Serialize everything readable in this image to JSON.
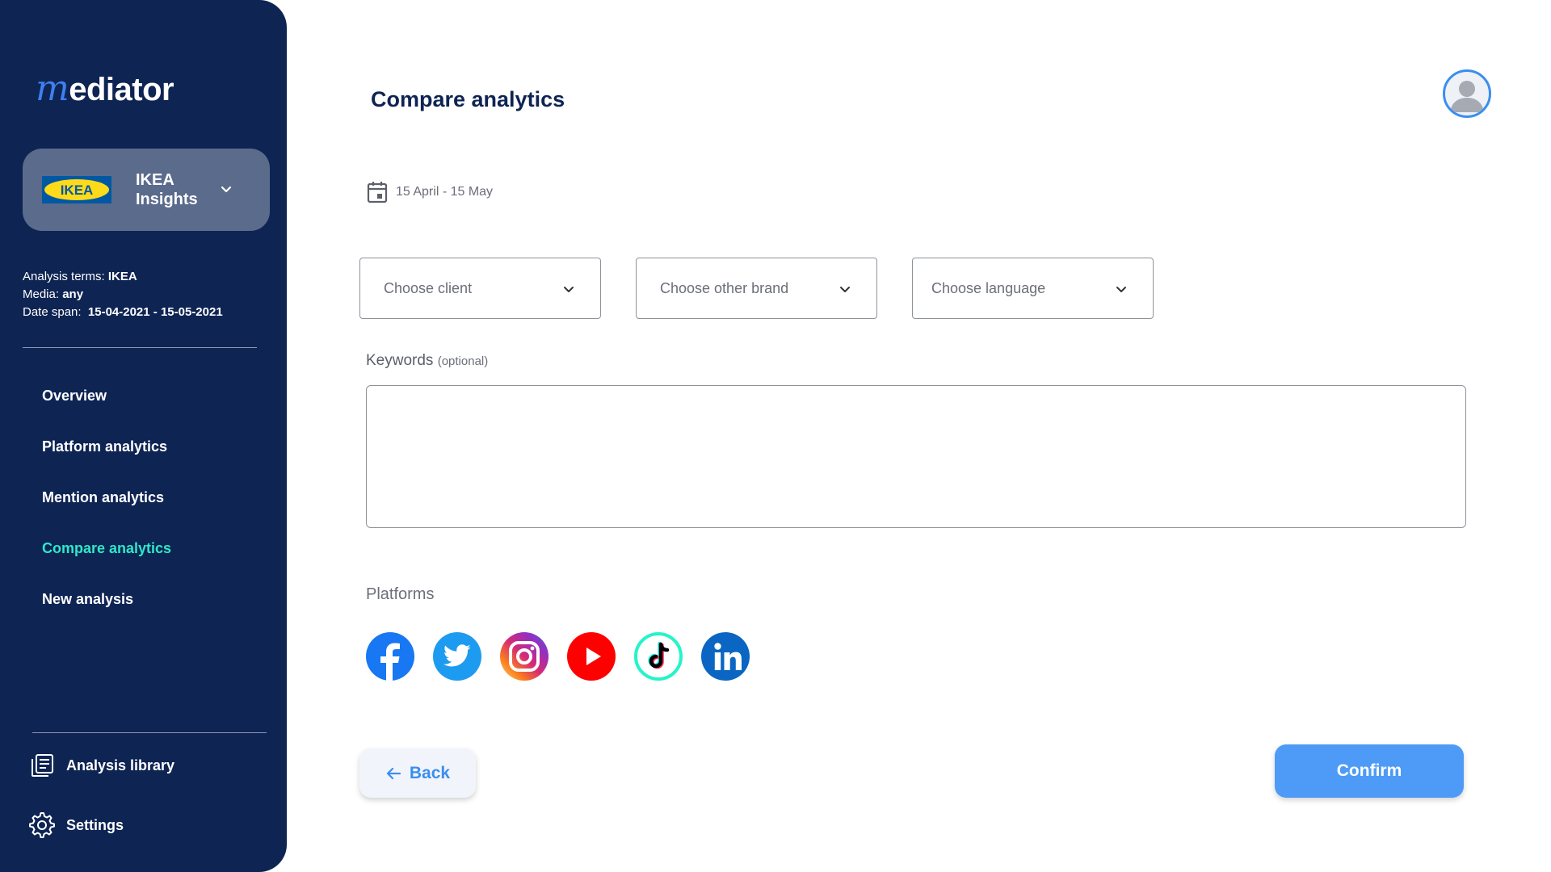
{
  "app": {
    "logo_m": "m",
    "logo_rest": "ediator"
  },
  "brand": {
    "logo_text": "IKEA",
    "line1": "IKEA",
    "line2": "Insights",
    "logo_blue": "#0058a3",
    "logo_yellow": "#ffda1a"
  },
  "analysis": {
    "terms_label": "Analysis terms:",
    "terms_value": "IKEA",
    "media_label": "Media:",
    "media_value": "any",
    "date_label": "Date span:",
    "date_value": "15-04-2021 - 15-05-2021"
  },
  "nav": {
    "items": [
      {
        "label": "Overview"
      },
      {
        "label": "Platform analytics"
      },
      {
        "label": "Mention analytics"
      },
      {
        "label": "Compare analytics"
      },
      {
        "label": "New analysis"
      }
    ],
    "active": "Compare analytics"
  },
  "bottom_nav": {
    "library": "Analysis library",
    "settings": "Settings"
  },
  "main": {
    "title": "Compare analytics",
    "date_range": "15 April - 15 May",
    "selects": {
      "client": "Choose client",
      "brand": "Choose other brand",
      "language": "Choose language"
    },
    "keywords_label": "Keywords",
    "keywords_optional": "(optional)",
    "keywords_value": "",
    "platforms_label": "Platforms",
    "platforms": [
      "facebook-icon",
      "twitter-icon",
      "instagram-icon",
      "youtube-icon",
      "tiktok-icon",
      "linkedin-icon"
    ],
    "back_label": "Back",
    "confirm_label": "Confirm"
  },
  "colors": {
    "sidebar": "#0e2453",
    "active_nav": "#2ee8c9",
    "accent": "#3a8ef0",
    "confirm": "#4d9bf6",
    "facebook": "#1877f2",
    "twitter": "#1d9bf0",
    "youtube": "#ff0000",
    "tiktok_ring": "#25f4c8",
    "linkedin": "#0a66c2"
  }
}
